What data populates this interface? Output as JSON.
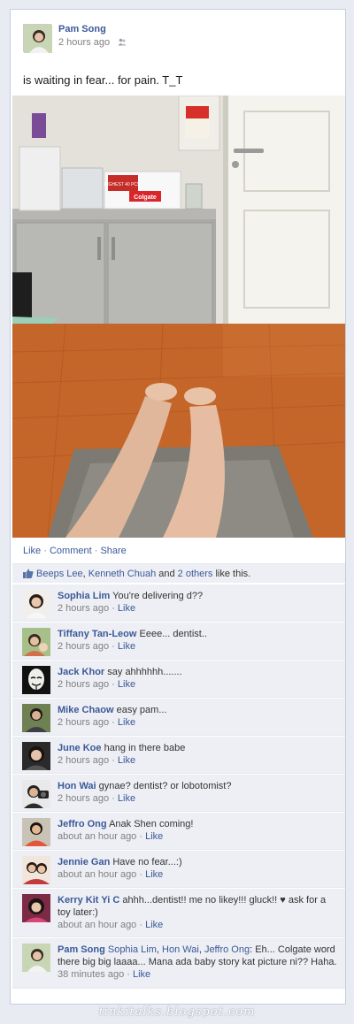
{
  "post": {
    "author": "Pam Song",
    "time": "2 hours ago",
    "status": "is waiting in fear... for pain. T_T"
  },
  "actions": {
    "like": "Like",
    "comment": "Comment",
    "share": "Share",
    "sep": " · "
  },
  "likes": {
    "name1": "Beeps Lee",
    "comma": ", ",
    "name2": "Kenneth Chuah",
    "and": " and ",
    "others": "2 others",
    "suffix": " like this."
  },
  "comments": [
    {
      "name": "Sophia Lim",
      "text": "You're delivering d??",
      "time": "2 hours ago",
      "like": "Like"
    },
    {
      "name": "Tiffany Tan-Leow",
      "text": "Eeee... dentist..",
      "time": "2 hours ago",
      "like": "Like"
    },
    {
      "name": "Jack Khor",
      "text": "say ahhhhhh.......",
      "time": "2 hours ago",
      "like": "Like"
    },
    {
      "name": "Mike Chaow",
      "text": "easy pam...",
      "time": "2 hours ago",
      "like": "Like"
    },
    {
      "name": "June Koe",
      "text": "hang in there babe",
      "time": "2 hours ago",
      "like": "Like"
    },
    {
      "name": "Hon Wai",
      "text": "gynae? dentist? or lobotomist?",
      "time": "2 hours ago",
      "like": "Like"
    },
    {
      "name": "Jeffro Ong",
      "text": "Anak Shen coming!",
      "time": "about an hour ago",
      "like": "Like"
    },
    {
      "name": "Jennie Gan",
      "text": "Have no fear...:)",
      "time": "about an hour ago",
      "like": "Like"
    },
    {
      "name": "Kerry Kit Yi C",
      "text": "ahhh...dentist!! me no likey!!! gluck!! ♥ ask for a toy later:)",
      "time": "about an hour ago",
      "like": "Like"
    },
    {
      "name": "Pam Song",
      "mention1": "Sophia Lim",
      "mention2": "Hon Wai",
      "mention3": "Jeffro Ong",
      "text": ": Eh... Colgate word there big big laaaa... Mana ada baby story kat picture ni?? Haha.",
      "time": "38 minutes ago",
      "like": "Like"
    }
  ],
  "photo_text": {
    "box": "HIGHEST 40 PCS",
    "brand": "Colgate"
  },
  "watermark": "tinkitalks.blogspot.com",
  "colors": {
    "link": "#3b5998",
    "comment_bg": "#edeff4",
    "page_bg": "#e9ebf2"
  }
}
